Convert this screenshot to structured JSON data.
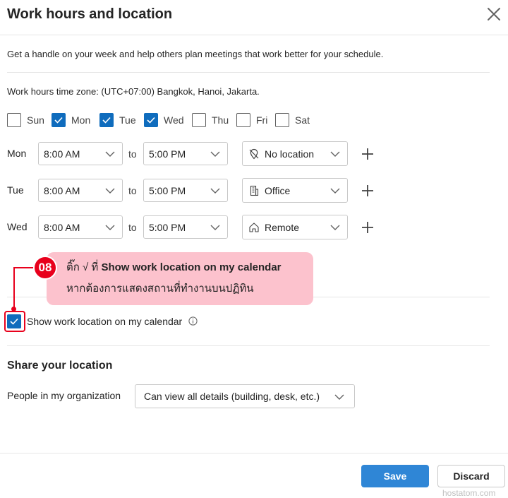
{
  "dialog": {
    "title": "Work hours and location",
    "intro": "Get a handle on your week and help others plan meetings that work better for your schedule.",
    "timezone_text": "Work hours time zone: (UTC+07:00) Bangkok, Hanoi, Jakarta."
  },
  "days": [
    {
      "label": "Sun",
      "checked": false
    },
    {
      "label": "Mon",
      "checked": true
    },
    {
      "label": "Tue",
      "checked": true
    },
    {
      "label": "Wed",
      "checked": true
    },
    {
      "label": "Thu",
      "checked": false
    },
    {
      "label": "Fri",
      "checked": false
    },
    {
      "label": "Sat",
      "checked": false
    }
  ],
  "schedule": [
    {
      "day": "Mon",
      "start": "8:00 AM",
      "to": "to",
      "end": "5:00 PM",
      "location": "No location",
      "location_icon": "no-location-icon"
    },
    {
      "day": "Tue",
      "start": "8:00 AM",
      "to": "to",
      "end": "5:00 PM",
      "location": "Office",
      "location_icon": "office-building-icon"
    },
    {
      "day": "Wed",
      "start": "8:00 AM",
      "to": "to",
      "end": "5:00 PM",
      "location": "Remote",
      "location_icon": "home-icon"
    }
  ],
  "callout": {
    "step": "08",
    "line1_prefix": "ติ๊ก √ ที่ ",
    "line1_bold": "Show work location on my calendar",
    "line2": "หากต้องการแสดงสถานที่ทำงานบนปฏิทิน"
  },
  "show_location": {
    "label": "Show work location on my calendar",
    "checked": true
  },
  "share": {
    "title": "Share your location",
    "people_label": "People in my organization",
    "people_value": "Can view all details (building, desk, etc.)"
  },
  "footer": {
    "save_label": "Save",
    "discard_label": "Discard"
  },
  "watermark": "hostatom.com",
  "colors": {
    "accent": "#0f6cbd",
    "save_button": "#2f86d6",
    "callout_bg": "#fcc2cd",
    "highlight_red": "#e8001c"
  }
}
